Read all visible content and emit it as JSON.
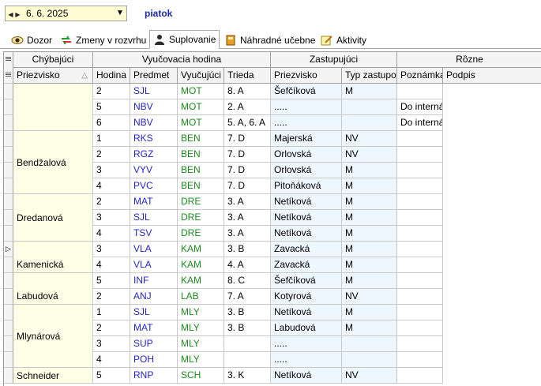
{
  "toolbar": {
    "date": "6. 6. 2025",
    "day": "piatok"
  },
  "tabs": [
    {
      "label": "Dozor",
      "icon": "eye-icon"
    },
    {
      "label": "Zmeny v rozvrhu",
      "icon": "swap-arrows-icon"
    },
    {
      "label": "Suplovanie",
      "icon": "person-icon",
      "active": true
    },
    {
      "label": "Náhradné učebne",
      "icon": "book-icon"
    },
    {
      "label": "Aktivity",
      "icon": "note-pencil-icon"
    }
  ],
  "header": {
    "groups": [
      "Chýbajúci",
      "Vyučovacia hodina",
      "Zastupujúci",
      "Rôzne"
    ],
    "columns": [
      "Priezvisko",
      "Hodina",
      "Predmet",
      "Vyučujúci",
      "Trieda",
      "Priezvisko",
      "Typ zastupov",
      "Poznámka",
      "Podpis"
    ]
  },
  "groups": [
    {
      "name": "",
      "rows": [
        [
          "2",
          "SJL",
          "MOT",
          "8. A",
          "Šefčíková",
          "M",
          ""
        ],
        [
          "5",
          "NBV",
          "MOT",
          "2. A",
          ".....",
          "",
          "Do interná"
        ],
        [
          "6",
          "NBV",
          "MOT",
          "5. A, 6. A",
          ".....",
          "",
          "Do interná"
        ]
      ]
    },
    {
      "name": "Bendžalová",
      "rows": [
        [
          "1",
          "RKS",
          "BEN",
          "7. D",
          "Majerská",
          "NV",
          ""
        ],
        [
          "2",
          "RGZ",
          "BEN",
          "7. D",
          "Orlovská",
          "NV",
          ""
        ],
        [
          "3",
          "VYV",
          "BEN",
          "7. D",
          "Orlovská",
          "M",
          ""
        ],
        [
          "4",
          "PVC",
          "BEN",
          "7. D",
          "Pitoňáková",
          "M",
          ""
        ]
      ]
    },
    {
      "name": "Dredanová",
      "rows": [
        [
          "2",
          "MAT",
          "DRE",
          "3. A",
          "Netíková",
          "M",
          ""
        ],
        [
          "3",
          "SJL",
          "DRE",
          "3. A",
          "Netíková",
          "M",
          ""
        ],
        [
          "4",
          "TSV",
          "DRE",
          "3. A",
          "Netíková",
          "M",
          ""
        ]
      ]
    },
    {
      "name": "Kamenická",
      "rows": [
        [
          "3",
          "VLA",
          "KAM",
          "3. B",
          "Zavacká",
          "M",
          ""
        ],
        [
          "4",
          "VLA",
          "KAM",
          "4. A",
          "Zavacká",
          "M",
          ""
        ]
      ]
    },
    {
      "name": "Labudová",
      "rows": [
        [
          "5",
          "INF",
          "KAM",
          "8. C",
          "Šefčíková",
          "M",
          ""
        ],
        [
          "2",
          "ANJ",
          "LAB",
          "7. A",
          "Kotyrová",
          "NV",
          ""
        ]
      ]
    },
    {
      "name": "Mlynárová",
      "rows": [
        [
          "1",
          "SJL",
          "MLY",
          "3. B",
          "Netíková",
          "M",
          ""
        ],
        [
          "2",
          "MAT",
          "MLY",
          "3. B",
          "Labudová",
          "M",
          ""
        ],
        [
          "3",
          "SUP",
          "MLY",
          "",
          ".....",
          "",
          ""
        ],
        [
          "4",
          "POH",
          "MLY",
          "",
          ".....",
          "",
          ""
        ]
      ]
    },
    {
      "name": "Schneider",
      "rows": [
        [
          "5",
          "RNP",
          "SCH",
          "3. K",
          "Netíková",
          "NV",
          ""
        ]
      ]
    }
  ]
}
